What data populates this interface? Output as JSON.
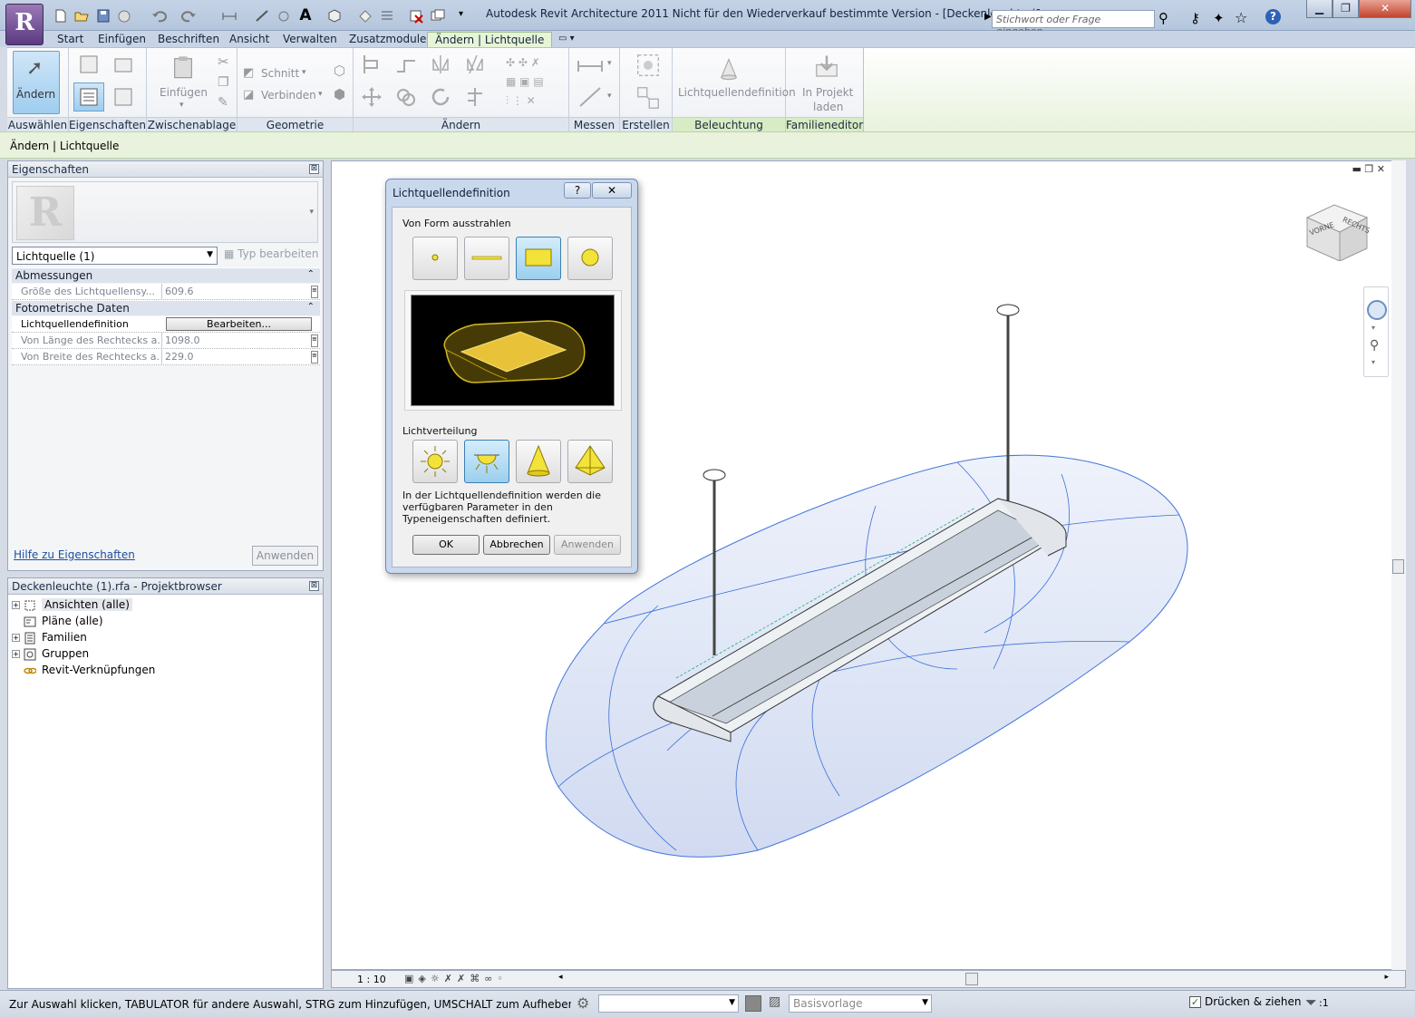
{
  "titlebar": {
    "app_button_letter": "R",
    "title": "Autodesk Revit Architecture 2011 Nicht für den Wiederverkauf bestimmte Version - [Deckenleuchte (1...",
    "search_placeholder": "Stichwort oder Frage eingeben"
  },
  "tabs": [
    "Start",
    "Einfügen",
    "Beschriften",
    "Ansicht",
    "Verwalten",
    "Zusatzmodule",
    "Ändern | Lichtquelle"
  ],
  "ribbon": {
    "panels": [
      "Auswählen",
      "Eigenschaften",
      "Zwischenablage",
      "Geometrie",
      "Ändern",
      "Messen",
      "Erstellen",
      "Beleuchtung",
      "Familieneditor"
    ],
    "aendern_label": "Ändern",
    "einfuegen_label": "Einfügen",
    "schnitt_label": "Schnitt",
    "verbinden_label": "Verbinden",
    "lichtquellendefinition_label": "Lichtquellendefinition",
    "in_projekt_label_1": "In Projekt",
    "in_projekt_label_2": "laden"
  },
  "context_bar": "Ändern | Lichtquelle",
  "properties": {
    "title": "Eigenschaften",
    "type_selector": "Lichtquelle (1)",
    "type_edit": "Typ bearbeiten",
    "group1": "Abmessungen",
    "row_size_name": "Größe des Lichtquellensy...",
    "row_size_value": "609.6",
    "group2": "Fotometrische Daten",
    "row_def_name": "Lichtquellendefinition",
    "row_def_button": "Bearbeiten...",
    "row_len_name": "Von Länge des Rechtecks a...",
    "row_len_value": "1098.0",
    "row_wid_name": "Von Breite des Rechtecks a...",
    "row_wid_value": "229.0",
    "help_link": "Hilfe zu Eigenschaften",
    "apply": "Anwenden"
  },
  "project_browser": {
    "title": "Deckenleuchte (1).rfa - Projektbrowser",
    "items": [
      "Ansichten (alle)",
      "Pläne (alle)",
      "Familien",
      "Gruppen",
      "Revit-Verknüpfungen"
    ]
  },
  "viewcube": {
    "front": "VORNE",
    "right": "RECHTS"
  },
  "view": {
    "scale": "1 : 10"
  },
  "status": {
    "text": "Zur Auswahl klicken, TABULATOR für andere Auswahl, STRG zum Hinzufügen, UMSCHALT zum Aufheben der Auswahl",
    "template": "Basisvorlage",
    "press_drag": "Drücken & ziehen",
    "filter_count": ":1"
  },
  "dialog": {
    "title": "Lichtquellendefinition",
    "help": "?",
    "close": "✕",
    "emit_label": "Von Form ausstrahlen",
    "emit_shapes": [
      "point",
      "line",
      "rectangle",
      "circle"
    ],
    "emit_selected": "rectangle",
    "distribution_label": "Lichtverteilung",
    "distributions": [
      "spherical",
      "hemispherical",
      "spot",
      "photometric-web"
    ],
    "distribution_selected": "hemispherical",
    "info": [
      "In der Lichtquellendefinition werden die",
      "verfügbaren Parameter in den",
      "Typeneigenschaften definiert."
    ],
    "ok": "OK",
    "cancel": "Abbrechen",
    "apply": "Anwenden"
  },
  "colors": {
    "accent": "#9ccfee",
    "context_green": "#e8f2dc",
    "light_yellow": "#f3e23a"
  }
}
